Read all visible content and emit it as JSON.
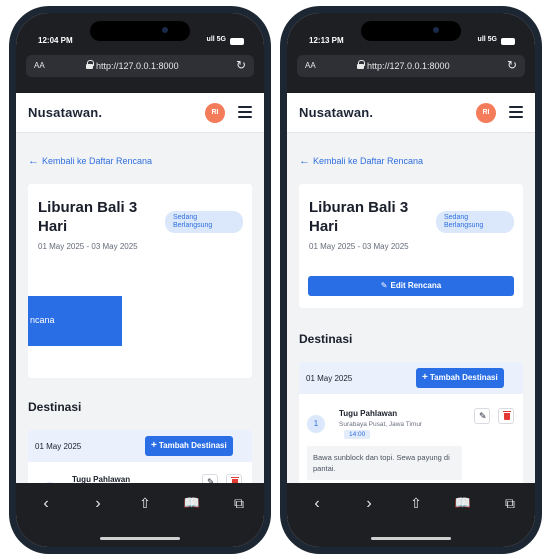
{
  "status": {
    "time_left": "12:04 PM",
    "time_right": "12:13 PM",
    "signal": "ull 5G"
  },
  "browser": {
    "aa_label": "AA",
    "url": "http://127.0.0.1:8000"
  },
  "app": {
    "brand": "Nusatawan.",
    "avatar_initials": "RI"
  },
  "back_link": "Kembali ke Daftar Rencana",
  "trip": {
    "title": "Liburan Bali 3 Hari",
    "status_badge": "Sedang Berlangsung",
    "dates": "01 May 2025 - 03 May 2025",
    "edit_label": "Edit Rencana",
    "edit_label_clipped": "ncana"
  },
  "destinations": {
    "section_title": "Destinasi",
    "add_label": "Tambah Destinasi",
    "days": [
      {
        "date": "01 May 2025",
        "items": [
          {
            "index": "1",
            "name": "Tugu Pahlawan",
            "location": "Surabaya Pusat, Jawa Timur",
            "time": "14:00",
            "note": "Bawa sunblock dan topi. Sewa payung di pantai."
          }
        ]
      }
    ]
  },
  "toolbar": {
    "back": "‹",
    "forward": "›",
    "share": "⇧",
    "bookmarks": "📖",
    "tabs": "⧉"
  },
  "colors": {
    "accent": "#2a6ee6",
    "avatar": "#f47c5a",
    "danger": "#e53935"
  }
}
